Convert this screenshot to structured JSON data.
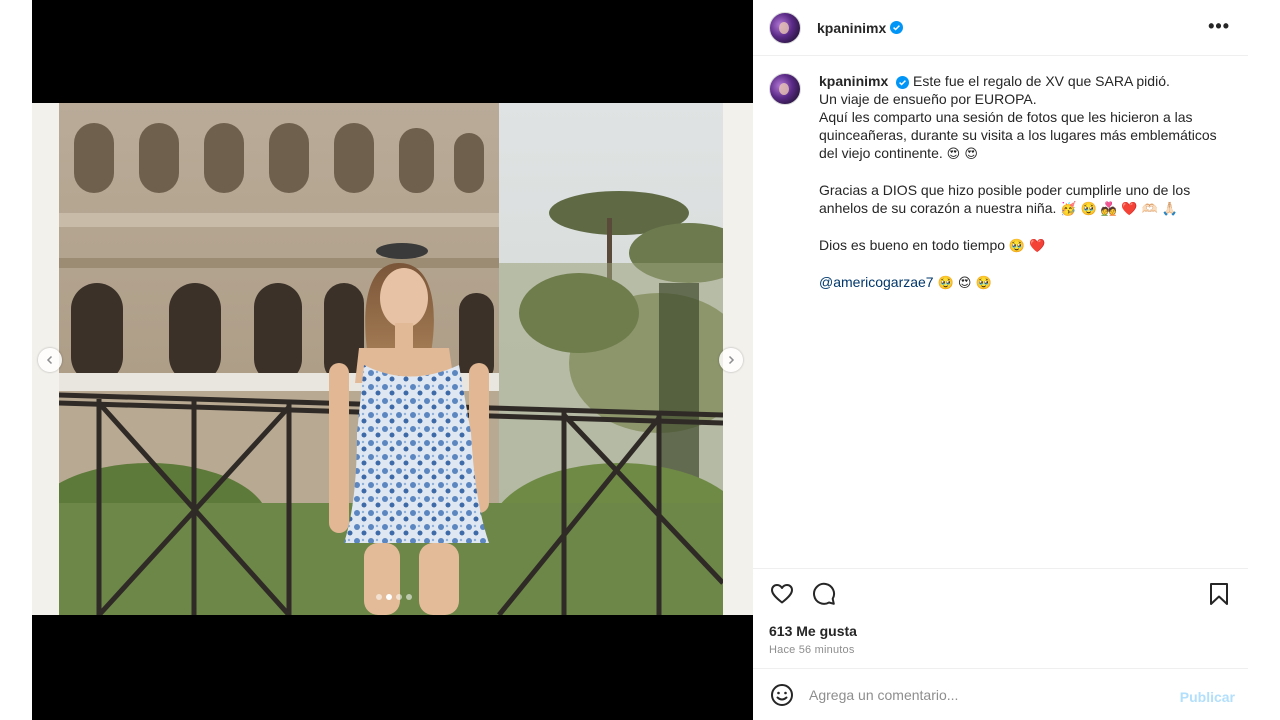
{
  "post": {
    "username": "kpaninimx",
    "more_label": "•••"
  },
  "caption": {
    "username": "kpaninimx",
    "line1": "Este fue el regalo de XV que SARA pidió.",
    "line2": "Un viaje de ensueño por EUROPA.",
    "line3": "Aquí les comparto una sesión de fotos que les hicieron a las quinceañeras, durante su visita a los lugares más emblemáticos del viejo continente.",
    "line3_emoji": "😍 😍",
    "line4": "Gracias a DIOS que hizo posible poder cumplirle uno de los anhelos de su corazón a nuestra niña.",
    "line4_emoji": "🥳 🥹 💑 ❤️ 🫶🏻 🙏🏻",
    "line5": "Dios es bueno en todo tiempo",
    "line5_emoji": "🥹 ❤️",
    "mention": "@americogarzae7",
    "mention_emoji": "🥹 😍 🥹"
  },
  "actions": {
    "likes": "613 Me gusta",
    "time": "Hace 56 minutos"
  },
  "comment": {
    "placeholder": "Agrega un comentario...",
    "publish_label": "Publicar"
  },
  "carousel": {
    "current_index": 1,
    "total": 4
  },
  "icons": {
    "verified": "verified-badge-icon",
    "like": "heart-icon",
    "comment": "comment-icon",
    "save": "bookmark-icon",
    "emoji": "emoji-icon",
    "prev": "chevron-left-icon",
    "next": "chevron-right-icon"
  },
  "colors": {
    "verified": "#0095f6",
    "mention": "#00376b",
    "publish_disabled": "#b2dffc",
    "secondary_text": "#8e8e8e"
  }
}
